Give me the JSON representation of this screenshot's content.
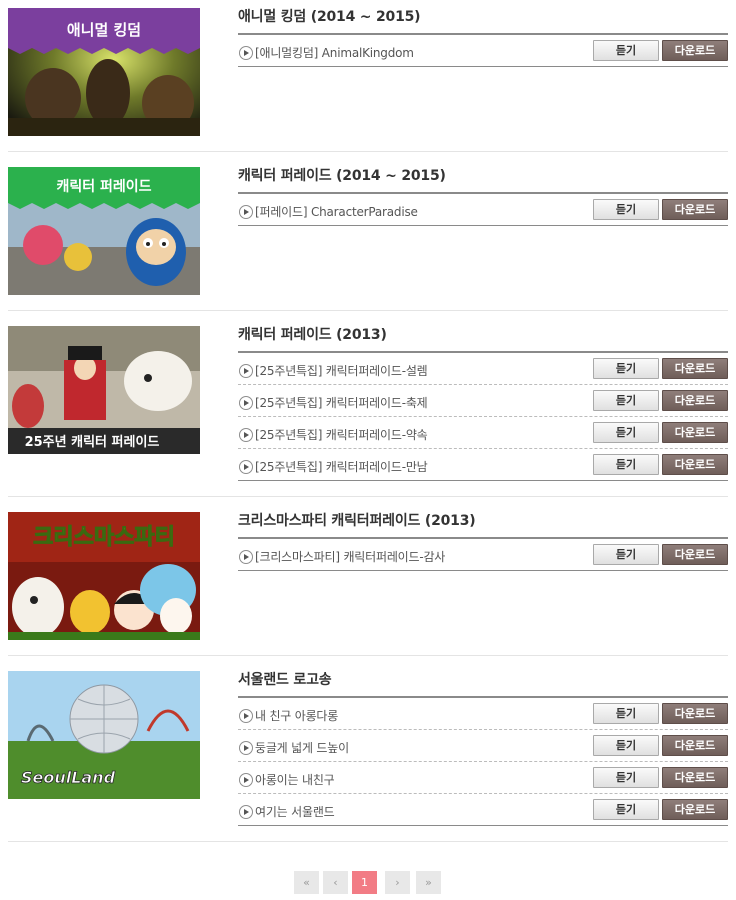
{
  "buttons": {
    "listen": "듣기",
    "download": "다운로드"
  },
  "albums": [
    {
      "title": "애니멀 킹덤 (2014 ~ 2015)",
      "banner_text": "애니멀 킹덤",
      "tracks": [
        "[애니멀킹덤] AnimalKingdom"
      ]
    },
    {
      "title": "캐릭터 퍼레이드 (2014 ~ 2015)",
      "banner_text": "캐릭터 퍼레이드",
      "tracks": [
        "[퍼레이드] CharacterParadise"
      ]
    },
    {
      "title": "캐릭터 퍼레이드 (2013)",
      "banner_text": "25주년 캐릭터 퍼레이드",
      "tracks": [
        "[25주년특집] 캐릭터퍼레이드-설렘",
        "[25주년특집] 캐릭터퍼레이드-축제",
        "[25주년특집] 캐릭터퍼레이드-약속",
        "[25주년특집] 캐릭터퍼레이드-만남"
      ]
    },
    {
      "title": "크리스마스파티 캐릭터퍼레이드 (2013)",
      "banner_text": "크리스마스파티",
      "tracks": [
        "[크리스마스파티] 캐릭터퍼레이드-감사"
      ]
    },
    {
      "title": "서울랜드 로고송",
      "banner_text": "SeoulLand",
      "tracks": [
        "내 친구 아롱다롱",
        "둥글게 넓게 드높이",
        "아롱이는 내친구",
        "여기는 서울랜드"
      ]
    }
  ],
  "pagination": {
    "first": "«",
    "prev": "‹",
    "current": "1",
    "next": "›",
    "last": "»"
  },
  "colors": {
    "download_button": "#7a6965",
    "current_page": "#f27c85",
    "banner_purple": "#7b3f9e",
    "banner_green": "#2bb14d"
  }
}
